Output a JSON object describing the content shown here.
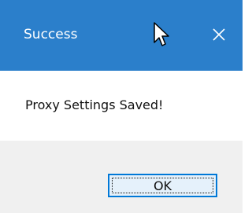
{
  "window": {
    "title": "Success",
    "close_icon": "close-icon",
    "accent_color": "#2b7fcb"
  },
  "message": {
    "text": "Proxy Settings Saved!"
  },
  "buttons": {
    "ok_label": "OK"
  },
  "pointer": {
    "icon": "mouse-pointer-icon"
  }
}
